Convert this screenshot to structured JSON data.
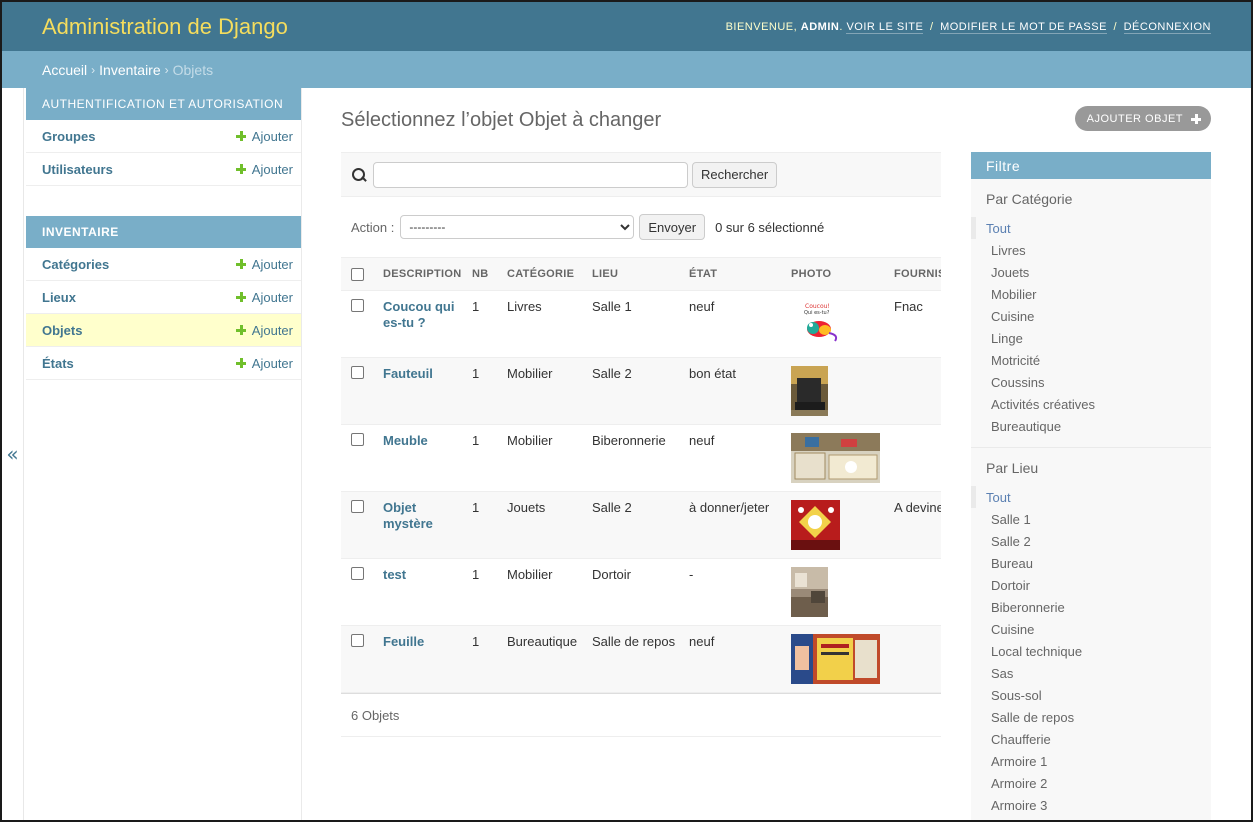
{
  "header": {
    "branding": "Administration de Django",
    "welcome": "Bienvenue,",
    "username": "admin",
    "links": [
      "Voir le site",
      "Modifier le mot de passe",
      "Déconnexion"
    ]
  },
  "breadcrumbs": [
    "Accueil",
    "Inventaire",
    "Objets"
  ],
  "sidebar": {
    "toggle": "«",
    "modules": [
      {
        "caption": "Authentification et autorisation",
        "items": [
          {
            "label": "Groupes",
            "add": "Ajouter"
          },
          {
            "label": "Utilisateurs",
            "add": "Ajouter"
          }
        ]
      },
      {
        "caption": "Inventaire",
        "items": [
          {
            "label": "Catégories",
            "add": "Ajouter"
          },
          {
            "label": "Lieux",
            "add": "Ajouter"
          },
          {
            "label": "Objets",
            "add": "Ajouter"
          },
          {
            "label": "États",
            "add": "Ajouter"
          }
        ]
      }
    ]
  },
  "page": {
    "title": "Sélectionnez l’objet Objet à changer",
    "add_button": "Ajouter objet"
  },
  "search": {
    "value": "",
    "button": "Rechercher"
  },
  "actions": {
    "label": "Action :",
    "selected_option": "---------",
    "go_button": "Envoyer",
    "counter": "0 sur 6 sélectionné"
  },
  "table": {
    "columns": [
      "Description",
      "Nb",
      "Catégorie",
      "Lieu",
      "État",
      "Photo",
      "Fournis"
    ],
    "rows": [
      {
        "description": "Coucou qui es-tu ?",
        "nb": "1",
        "categorie": "Livres",
        "lieu": "Salle 1",
        "etat": "neuf",
        "fournisseur": "Fnac",
        "photo": "book-cover"
      },
      {
        "description": "Fauteuil",
        "nb": "1",
        "categorie": "Mobilier",
        "lieu": "Salle 2",
        "etat": "bon état",
        "fournisseur": "",
        "photo": "armchair-photo"
      },
      {
        "description": "Meuble",
        "nb": "1",
        "categorie": "Mobilier",
        "lieu": "Biberonnerie",
        "etat": "neuf",
        "fournisseur": "",
        "photo": "furniture-photo"
      },
      {
        "description": "Objet mystère",
        "nb": "1",
        "categorie": "Jouets",
        "lieu": "Salle 2",
        "etat": "à donner/jeter",
        "fournisseur": "A devine",
        "photo": "mystery-photo"
      },
      {
        "description": "test",
        "nb": "1",
        "categorie": "Mobilier",
        "lieu": "Dortoir",
        "etat": "-",
        "fournisseur": "",
        "photo": "room-photo"
      },
      {
        "description": "Feuille",
        "nb": "1",
        "categorie": "Bureautique",
        "lieu": "Salle de repos",
        "etat": "neuf",
        "fournisseur": "",
        "photo": "paper-photo"
      }
    ]
  },
  "paginator": "6 Objets",
  "filter": {
    "title": "Filtre",
    "groups": [
      {
        "title": "Par Catégorie",
        "options": [
          "Tout",
          "Livres",
          "Jouets",
          "Mobilier",
          "Cuisine",
          "Linge",
          "Motricité",
          "Coussins",
          "Activités créatives",
          "Bureautique"
        ]
      },
      {
        "title": "Par Lieu",
        "options": [
          "Tout",
          "Salle 1",
          "Salle 2",
          "Bureau",
          "Dortoir",
          "Biberonnerie",
          "Cuisine",
          "Local technique",
          "Sas",
          "Sous-sol",
          "Salle de repos",
          "Chaufferie",
          "Armoire 1",
          "Armoire 2",
          "Armoire 3"
        ]
      }
    ]
  },
  "colors": {
    "header": "#417690",
    "branding": "#f5dd5d",
    "caption": "#79aec8",
    "link": "#417690",
    "add_plus": "#70bf2b",
    "current_row": "#ffffcc"
  }
}
